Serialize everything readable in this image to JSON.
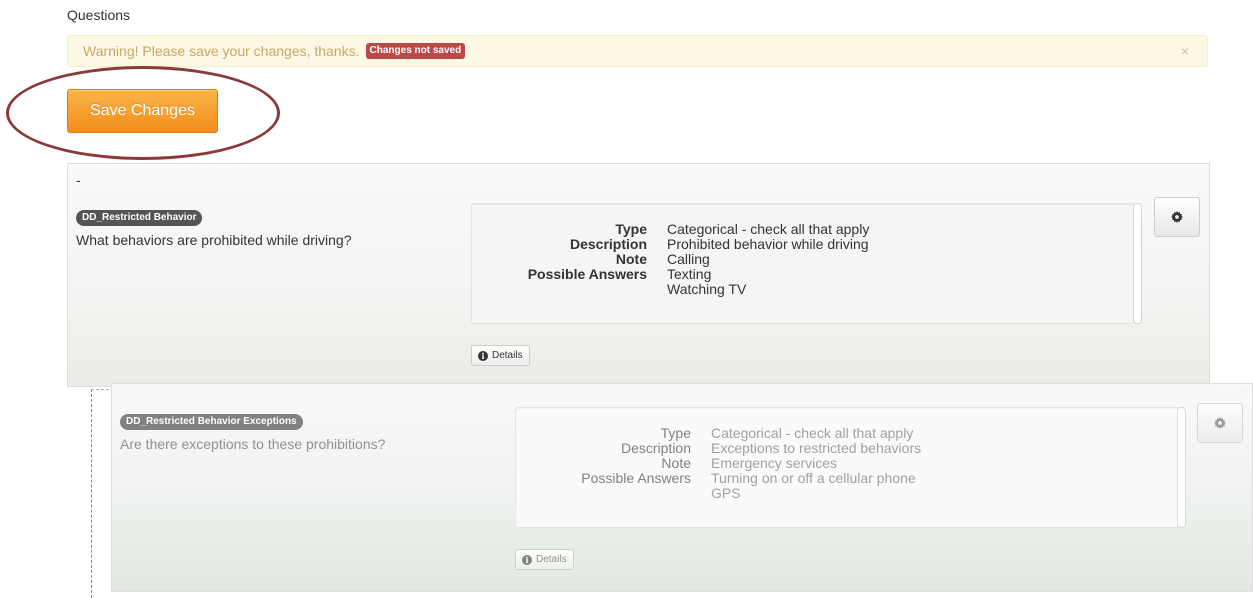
{
  "section": {
    "title": "Questions"
  },
  "alert": {
    "message": "Warning! Please save your changes, thanks.",
    "badge": "Changes not saved",
    "close": "×"
  },
  "save_button": {
    "label": "Save Changes"
  },
  "questions": [
    {
      "prefix": "-",
      "tag": "DD_Restricted Behavior",
      "text": "What behaviors are prohibited while driving?",
      "details": {
        "type_label": "Type",
        "type_value": "Categorical - check all that apply",
        "description_label": "Description",
        "description_value": "Prohibited behavior while driving",
        "note_label": "Note",
        "note_value": "Calling",
        "answers_label": "Possible Answers",
        "answers": [
          "Texting",
          "Watching TV"
        ]
      },
      "details_button": "Details"
    },
    {
      "tag": "DD_Restricted Behavior Exceptions",
      "text": "Are there exceptions to these prohibitions?",
      "details": {
        "type_label": "Type",
        "type_value": "Categorical - check all that apply",
        "description_label": "Description",
        "description_value": "Exceptions to restricted behaviors",
        "note_label": "Note",
        "note_value": "Emergency services",
        "answers_label": "Possible Answers",
        "answers": [
          "Turning on or off a cellular phone",
          "GPS"
        ]
      },
      "details_button": "Details"
    }
  ],
  "colors": {
    "save_button": "#f7a02c",
    "warning_bg": "#fcf8e3",
    "badge_danger": "#b94a48",
    "annotation": "#8b3a3a"
  },
  "icons": {
    "gear": "gear-icon",
    "info": "info-icon",
    "close": "close-icon"
  }
}
